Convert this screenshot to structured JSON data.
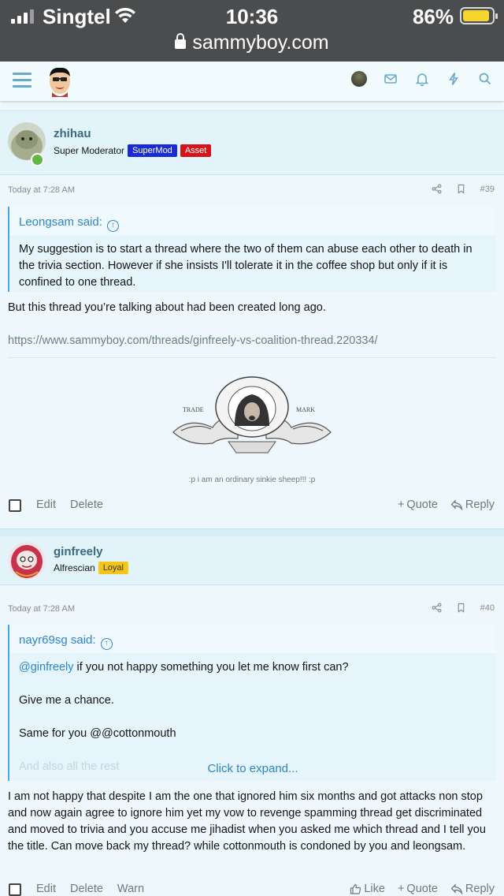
{
  "status_bar": {
    "carrier": "Singtel",
    "time": "10:36",
    "battery": "86%",
    "url": "sammyboy.com"
  },
  "header": {
    "icons": [
      "menu-icon",
      "site-logo",
      "user-avatar",
      "mail-icon",
      "bell-icon",
      "bolt-icon",
      "search-icon"
    ]
  },
  "posts": [
    {
      "username": "zhihau",
      "user_title": "Super Moderator",
      "badges": [
        {
          "label": "SuperMod",
          "color": "#1a2ccf"
        },
        {
          "label": "Asset",
          "color": "#d4141a"
        }
      ],
      "timestamp": "Today at 7:28 AM",
      "post_number": "#39",
      "quote": {
        "author": "Leongsam said:",
        "text": "My suggestion is to start a thread where the two of them can abuse each other to death in the trivia section. However if she insists I'll tolerate it in the coffee shop but only if it is confined to one thread."
      },
      "body": "But this thread you’re talking about had been created long ago.",
      "link": "https://www.sammyboy.com/threads/ginfreely-vs-coalition-thread.220334/",
      "signature_image_text": {
        "left": "TRADE",
        "right": "MARK"
      },
      "signature": ":p i am an ordinary sinkie sheep!!! :p",
      "actions_left": [
        "Edit",
        "Delete"
      ],
      "actions_right": [
        "Quote",
        "Reply"
      ]
    },
    {
      "username": "ginfreely",
      "user_title": "Alfrescian",
      "badges": [
        {
          "label": "Loyal",
          "color": "#f5c518"
        }
      ],
      "timestamp": "Today at 7:28 AM",
      "post_number": "#40",
      "quote": {
        "author": "nayr69sg said:",
        "mention": "@ginfreely",
        "line1_rest": " if you not happy something you let me know first can?",
        "line2": "Give me a chance.",
        "line3": "Same for you @@cottonmouth",
        "line4": "And also all the rest",
        "expand": "Click to expand..."
      },
      "body": "I am not happy that despite I am the one that ignored him six months and got attacks non stop and now again agree to ignore him yet my vow to revenge spamming thread get discriminated and moved to trivia and you accuse me jihadist when you asked me which thread and I tell you the title. Can move back my thread? while cottonmouth is condoned by you and leongsam.",
      "actions_left": [
        "Edit",
        "Delete",
        "Warn"
      ],
      "actions_right": [
        "Like",
        "Quote",
        "Reply"
      ]
    }
  ],
  "colors": {
    "accent": "#2a86c7",
    "page_bg": "#eef7fb",
    "post_head_bg": "#e2f4fa"
  }
}
